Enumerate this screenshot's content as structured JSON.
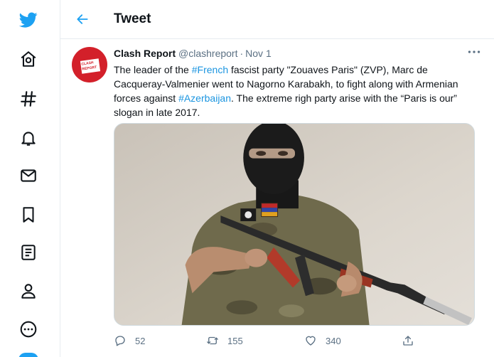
{
  "colors": {
    "brand": "#1da1f2",
    "hashtag": "#1b95e0",
    "muted": "#5b7083",
    "avatar_bg": "#d3202a"
  },
  "nav": {
    "items": [
      {
        "name": "twitter-logo",
        "icon": "bird-icon"
      },
      {
        "name": "home",
        "icon": "home-icon"
      },
      {
        "name": "explore",
        "icon": "hashtag-icon"
      },
      {
        "name": "notifications",
        "icon": "bell-icon"
      },
      {
        "name": "messages",
        "icon": "mail-icon"
      },
      {
        "name": "bookmarks",
        "icon": "bookmark-icon"
      },
      {
        "name": "lists",
        "icon": "list-icon"
      },
      {
        "name": "profile",
        "icon": "person-icon"
      },
      {
        "name": "more",
        "icon": "more-circle-icon"
      }
    ]
  },
  "header": {
    "title": "Tweet"
  },
  "tweet": {
    "avatar_text_line1": "CLASH",
    "avatar_text_line2": "REPORT",
    "author_name": "Clash Report",
    "handle": "@clashreport",
    "separator": "·",
    "date": "Nov 1",
    "text": {
      "p1": "The leader of the ",
      "tag1": "#French",
      "p2": " fascist party \"Zouaves Paris\" (ZVP), Marc de Cacqueray-Valmenier went to Nagorno Karabakh, to fight along with Armenian forces against ",
      "tag2": "#Azerbaijan",
      "p3": ". The extreme righ party arise with the “Paris is our” slogan in late 2017."
    },
    "actions": {
      "replies": "52",
      "retweets": "155",
      "likes": "340"
    }
  }
}
